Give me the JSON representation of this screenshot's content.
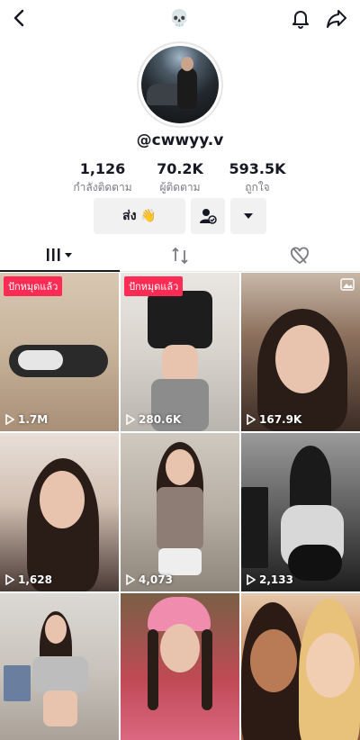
{
  "header": {
    "center_emoji": "💀"
  },
  "profile": {
    "username": "@cwwyy.v",
    "stats": [
      {
        "value": "1,126",
        "label": "กำลังติดตาม"
      },
      {
        "value": "70.2K",
        "label": "ผู้ติดตาม"
      },
      {
        "value": "593.5K",
        "label": "ถูกใจ"
      }
    ],
    "message_button": "ส่ง 👋"
  },
  "videos": [
    {
      "views": "1.7M",
      "badge": "ปักหมุดแล้ว"
    },
    {
      "views": "280.6K",
      "badge": "ปักหมุดแล้ว"
    },
    {
      "views": "167.9K",
      "badge": ""
    },
    {
      "views": "1,628",
      "badge": ""
    },
    {
      "views": "4,073",
      "badge": ""
    },
    {
      "views": "2,133",
      "badge": ""
    },
    {
      "views": "",
      "badge": ""
    },
    {
      "views": "",
      "badge": ""
    },
    {
      "views": "",
      "badge": ""
    }
  ],
  "icons": {
    "back": "chevron-left-icon",
    "notifications": "bell-icon",
    "share": "share-arrow-icon",
    "add_friend": "person-check-icon",
    "more": "caret-down-icon",
    "videos_tab": "grid-bars-icon",
    "reposts_tab": "repost-icon",
    "liked_tab": "heart-hidden-icon",
    "play": "play-icon",
    "photo": "photo-icon"
  },
  "colors": {
    "accent": "#fe2c55",
    "button_bg": "#f1f1f2",
    "text": "#161823",
    "muted": "#7a7b80"
  }
}
